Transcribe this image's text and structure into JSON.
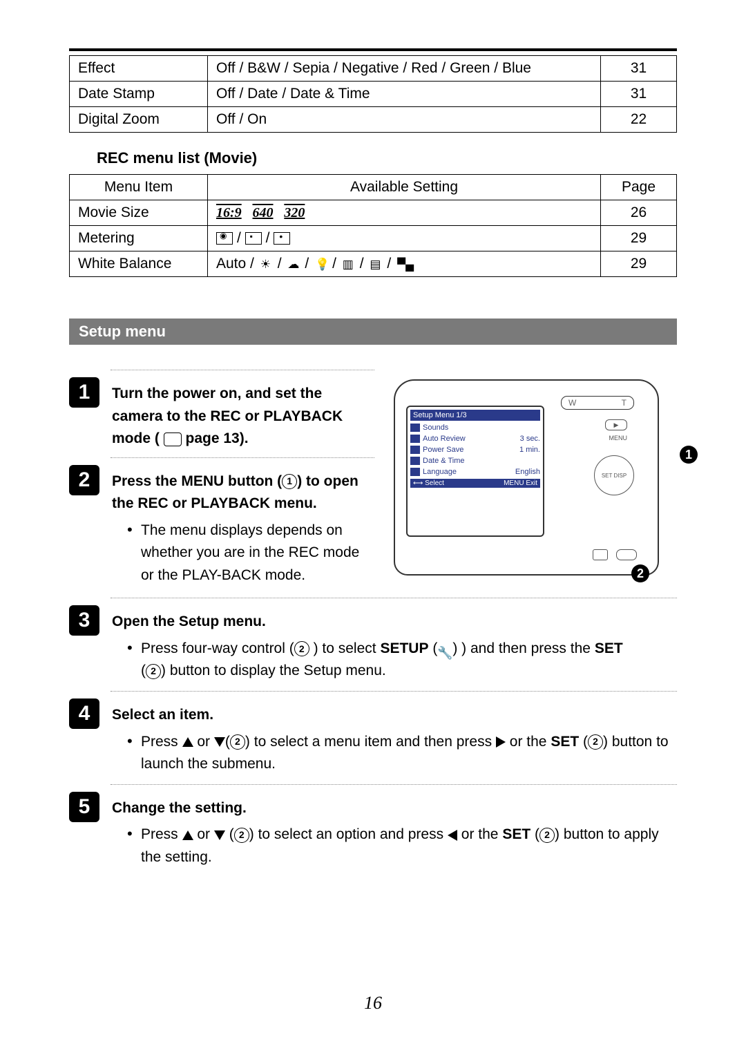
{
  "top_table": {
    "rows": [
      {
        "item": "Effect",
        "setting": "Off / B&W / Sepia / Negative / Red / Green / Blue",
        "page": "31"
      },
      {
        "item": "Date Stamp",
        "setting": "Off / Date / Date & Time",
        "page": "31"
      },
      {
        "item": "Digital Zoom",
        "setting": "Off / On",
        "page": "22"
      }
    ]
  },
  "rec_heading": "REC menu list (Movie)",
  "rec_table": {
    "headers": {
      "item": "Menu Item",
      "setting": "Available Setting",
      "page": "Page"
    },
    "rows": [
      {
        "item": "Movie Size",
        "setting_icons": [
          "16:9",
          "640",
          "320"
        ],
        "page": "26"
      },
      {
        "item": "Metering",
        "page": "29"
      },
      {
        "item": "White Balance",
        "setting_prefix": "Auto /",
        "page": "29"
      }
    ]
  },
  "setup_bar": "Setup menu",
  "steps": [
    {
      "num": "1",
      "title_a": "Turn the power on, and set the camera to the REC or PLAYBACK mode (",
      "title_b": "page 13)."
    },
    {
      "num": "2",
      "title_a": "Press the MENU button (",
      "title_b": ") to open the REC or PLAYBACK menu.",
      "bullet": "The menu displays depends on whether you are in the REC mode or the PLAY-BACK mode."
    },
    {
      "num": "3",
      "title": "Open the Setup menu.",
      "bullet_a": "Press four-way control (",
      "bullet_b": ") to select",
      "bullet_c": "SETUP",
      "bullet_d": "(",
      "bullet_e": ") and then press the",
      "bullet_f": "SET",
      "bullet_g": "(",
      "bullet_h": ") button to display the Setup menu."
    },
    {
      "num": "4",
      "title": "Select an item.",
      "bullet_a": "Press",
      "bullet_b": "or",
      "bullet_c": "(",
      "bullet_d": ") to select a menu item and then press",
      "bullet_e": "or the",
      "bullet_f": "SET",
      "bullet_g": "(",
      "bullet_h": ") button to launch the submenu."
    },
    {
      "num": "5",
      "title": "Change the setting.",
      "bullet_a": "Press",
      "bullet_b": "or",
      "bullet_c": "(",
      "bullet_d": ") to select an option and press",
      "bullet_e": "or the",
      "bullet_f": "SET",
      "bullet_g": "(",
      "bullet_h": ") button to apply the setting."
    }
  ],
  "camera_lcd": {
    "title": "Setup Menu 1/3",
    "rows": [
      {
        "label": "Sounds",
        "value": ""
      },
      {
        "label": "Auto Review",
        "value": "3 sec."
      },
      {
        "label": "Power Save",
        "value": "1 min."
      },
      {
        "label": "Date & Time",
        "value": ""
      },
      {
        "label": "Language",
        "value": "English"
      }
    ],
    "foot_left": "⟷ Select",
    "foot_right": "MENU Exit",
    "zoom_w": "W",
    "zoom_t": "T",
    "menu_label": "MENU",
    "dpad_label": "SET DISP"
  },
  "callouts": {
    "one": "1",
    "two": "2"
  },
  "page_number": "16"
}
